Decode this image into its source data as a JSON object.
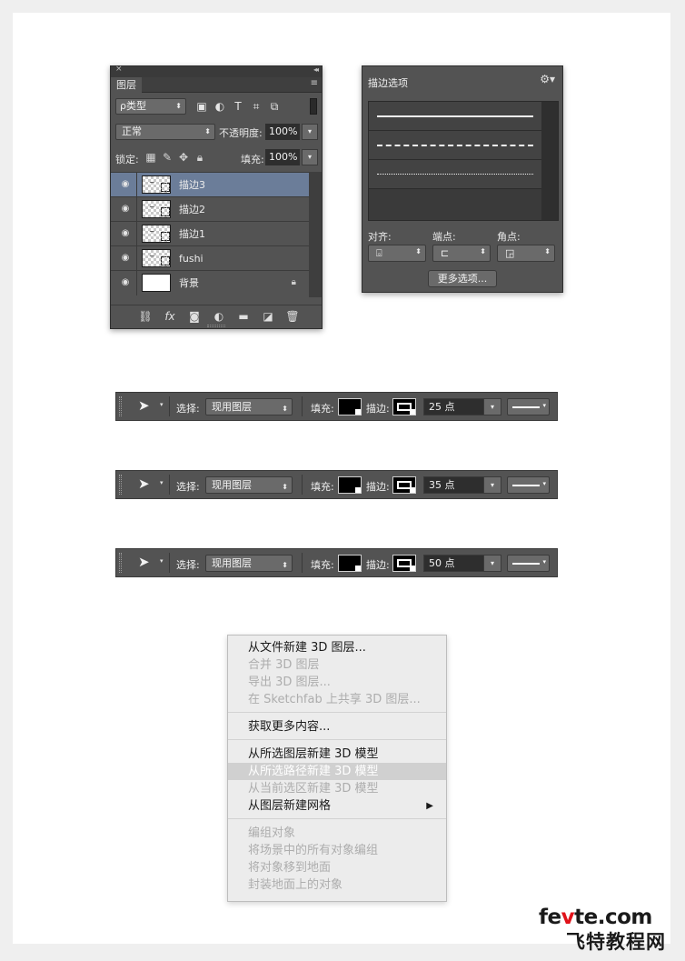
{
  "layers_panel": {
    "close": "×",
    "collapse": "◂◂",
    "tab": "图层",
    "filter_label": "ρ类型",
    "blend_mode": "正常",
    "opacity_label": "不透明度:",
    "opacity_value": "100%",
    "lock_label": "锁定:",
    "fill_label": "填充:",
    "fill_value": "100%",
    "layers": [
      {
        "name": "描边3",
        "selected": true,
        "thumb": "path"
      },
      {
        "name": "描边2",
        "selected": false,
        "thumb": "path"
      },
      {
        "name": "描边1",
        "selected": false,
        "thumb": "path"
      },
      {
        "name": "fushi",
        "selected": false,
        "thumb": "path"
      },
      {
        "name": "背景",
        "selected": false,
        "thumb": "white",
        "locked": true
      }
    ],
    "bottom_icons": [
      "link-icon",
      "fx-icon",
      "mask-icon",
      "adjustment-icon",
      "folder-icon",
      "new-layer-icon",
      "trash-icon"
    ],
    "fx_text": "fx"
  },
  "stroke_panel": {
    "title": "描边选项",
    "presets": [
      "solid",
      "dashed",
      "dotted"
    ],
    "align_label": "对齐:",
    "caps_label": "端点:",
    "corners_label": "角点:",
    "more_button": "更多选项..."
  },
  "option_bars": [
    {
      "select_label": "选择:",
      "select_value": "现用图层",
      "fill_label": "填充:",
      "stroke_label": "描边:",
      "width_value": "25 点"
    },
    {
      "select_label": "选择:",
      "select_value": "现用图层",
      "fill_label": "填充:",
      "stroke_label": "描边:",
      "width_value": "35 点"
    },
    {
      "select_label": "选择:",
      "select_value": "现用图层",
      "fill_label": "填充:",
      "stroke_label": "描边:",
      "width_value": "50 点"
    }
  ],
  "menu": {
    "groups": [
      [
        {
          "label": "从文件新建 3D 图层...",
          "enabled": true
        },
        {
          "label": "合并 3D 图层",
          "enabled": false
        },
        {
          "label": "导出 3D 图层...",
          "enabled": false
        },
        {
          "label": "在 Sketchfab 上共享 3D 图层...",
          "enabled": false
        }
      ],
      [
        {
          "label": "获取更多内容...",
          "enabled": true
        }
      ],
      [
        {
          "label": "从所选图层新建 3D 模型",
          "enabled": true
        },
        {
          "label": "从所选路径新建 3D 模型",
          "enabled": true,
          "highlighted": true
        },
        {
          "label": "从当前选区新建 3D 模型",
          "enabled": false
        },
        {
          "label": "从图层新建网格",
          "enabled": true,
          "submenu": true
        }
      ],
      [
        {
          "label": "编组对象",
          "enabled": false
        },
        {
          "label": "将场景中的所有对象编组",
          "enabled": false
        },
        {
          "label": "将对象移到地面",
          "enabled": false
        },
        {
          "label": "封装地面上的对象",
          "enabled": false
        }
      ]
    ]
  },
  "watermark": {
    "line1_a": "fe",
    "line1_b": "v",
    "line1_c": "te.com",
    "line2": "飞特教程网"
  },
  "colors": {
    "panel_bg": "#535353",
    "selected_layer": "#6b7d99",
    "watermark_accent": "#e0121a"
  }
}
